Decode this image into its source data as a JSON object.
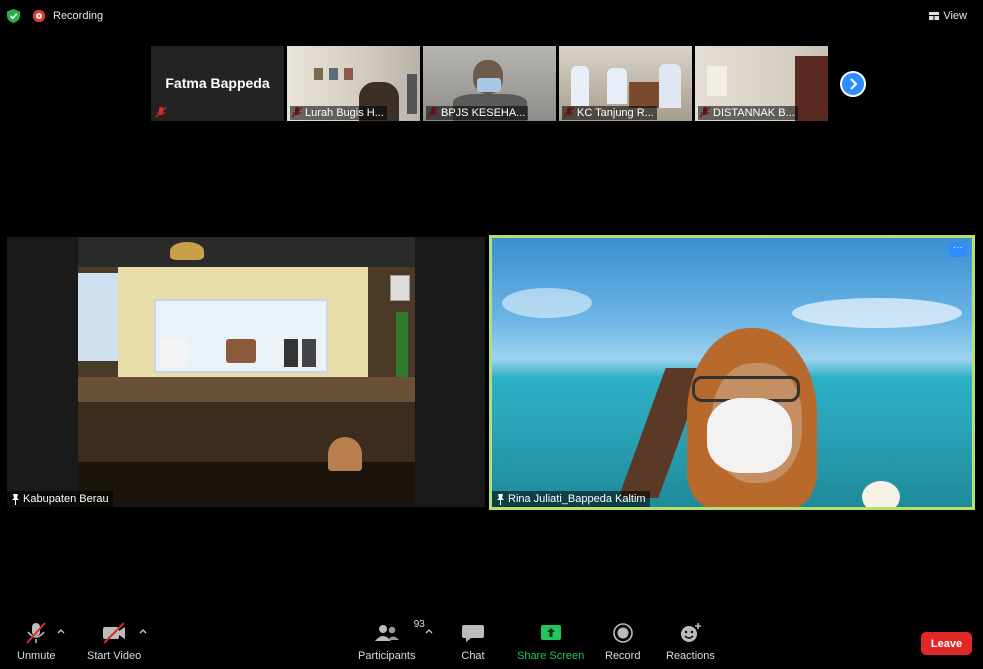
{
  "topbar": {
    "recording_label": "Recording",
    "view_label": "View"
  },
  "thumbnails": [
    {
      "name": "Fatma Bappeda",
      "display_name": "Fatma Bappeda",
      "muted": true,
      "video": false
    },
    {
      "name": "Lurah Bugis H...",
      "muted": true,
      "video": true
    },
    {
      "name": "BPJS KESEHA...",
      "muted": true,
      "video": true
    },
    {
      "name": "KC Tanjung R...",
      "muted": true,
      "video": true
    },
    {
      "name": "DISTANNAK B...",
      "muted": true,
      "video": true
    }
  ],
  "main_tiles": {
    "left": {
      "name": "Kabupaten Berau"
    },
    "right": {
      "name": "Rina Juliati_Bappeda Kaltim",
      "more": "···",
      "active_speaker_color": "#b7df6f"
    }
  },
  "toolbar": {
    "unmute": "Unmute",
    "start_video": "Start Video",
    "participants": "Participants",
    "participants_count": "93",
    "chat": "Chat",
    "share_screen": "Share Screen",
    "record": "Record",
    "reactions": "Reactions",
    "leave": "Leave"
  },
  "colors": {
    "accent": "#2d8cff",
    "share_green": "#22c55e",
    "leave_red": "#e02828",
    "recording_red": "#e3342f"
  }
}
